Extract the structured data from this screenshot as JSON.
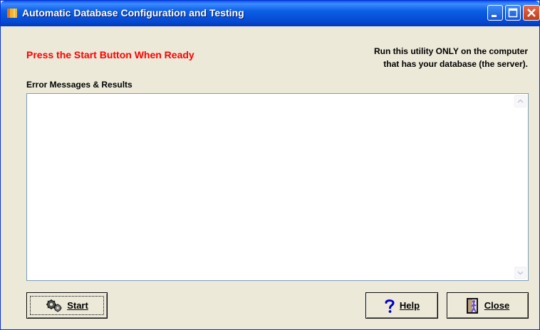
{
  "window": {
    "title": "Automatic Database Configuration and Testing",
    "icons": {
      "app": "book-icon",
      "minimize": "minimize-icon",
      "maximize": "maximize-icon",
      "close": "close-x-icon"
    }
  },
  "main": {
    "prompt": "Press the Start Button When Ready",
    "prompt_color": "#ff0000",
    "server_note_line1": "Run this utility ONLY on the computer",
    "server_note_line2": "that has your database (the server).",
    "results_label": "Error Messages & Results",
    "results_value": ""
  },
  "buttons": {
    "start": {
      "label": "Start",
      "icon": "gears-icon"
    },
    "help": {
      "label": "Help",
      "icon": "question-mark-icon"
    },
    "close": {
      "label": "Close",
      "icon": "door-exit-icon"
    }
  }
}
